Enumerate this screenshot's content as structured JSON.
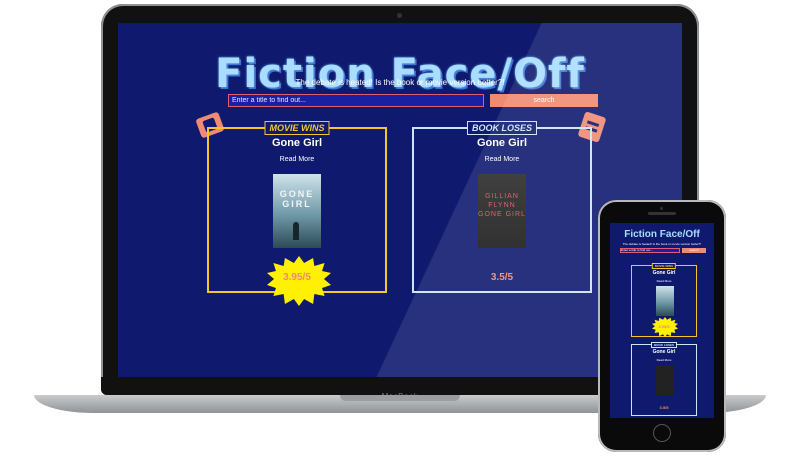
{
  "app": {
    "title": "Fiction Face/Off",
    "tagline": "The debate is heated! Is the book or movie version better?!",
    "search": {
      "placeholder": "Enter a title to find out...",
      "button_label": "search"
    }
  },
  "cards": {
    "movie": {
      "badge": "MOVIE WINS",
      "title": "Gone Girl",
      "read_more": "Read More",
      "rating": "3.95/5",
      "poster_text": "GONE GIRL"
    },
    "book": {
      "badge": "BOOK LOSES",
      "title": "Gone Girl",
      "read_more": "Read More",
      "rating": "3.5/5",
      "poster_text": "GILLIAN FLYNN GONE GIRL"
    }
  },
  "device": {
    "laptop_label": "MacBook"
  },
  "icons": {
    "movie": "film-icon",
    "book": "book-icon"
  },
  "colors": {
    "background": "#0f1a6e",
    "title": "#a9dcff",
    "accent": "#ef8a73",
    "movie_border": "#f5c52a",
    "book_border": "#c9e6f6",
    "starburst": "#fff100"
  }
}
